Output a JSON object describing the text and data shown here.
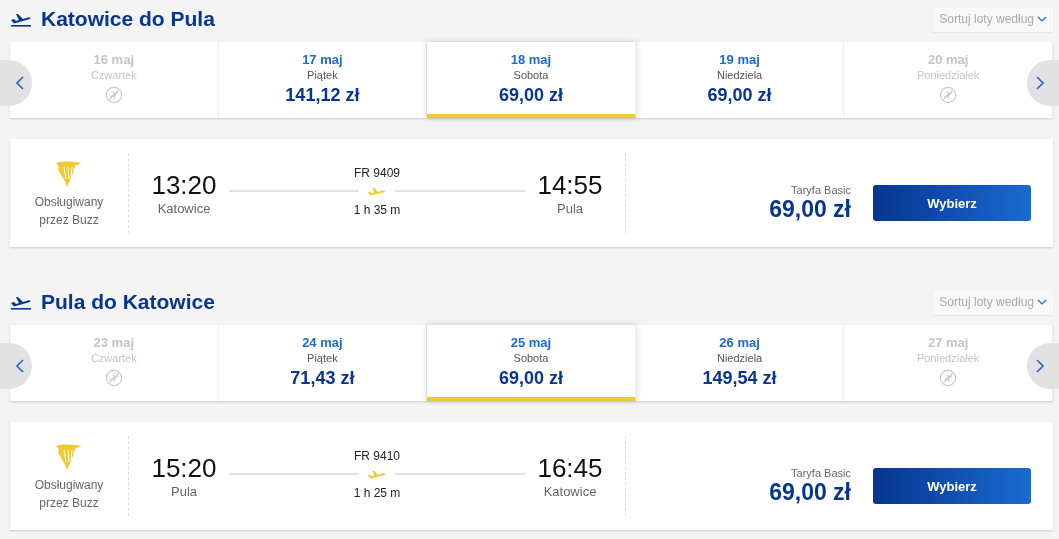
{
  "sections": [
    {
      "title": "Katowice do Pula",
      "sort": {
        "label": "Sortuj loty według"
      },
      "dates": [
        {
          "date": "16 maj",
          "day": "Czwartek",
          "available": false,
          "selected": false
        },
        {
          "date": "17 maj",
          "day": "Piątek",
          "price": "141,12 zł",
          "available": true,
          "selected": false
        },
        {
          "date": "18 maj",
          "day": "Sobota",
          "price": "69,00 zł",
          "available": true,
          "selected": true
        },
        {
          "date": "19 maj",
          "day": "Niedziela",
          "price": "69,00 zł",
          "available": true,
          "selected": false
        },
        {
          "date": "20 maj",
          "day": "Poniedziałek",
          "available": false,
          "selected": false
        }
      ],
      "flight": {
        "operator": "Obsługiwany przez Buzz",
        "departure_time": "13:20",
        "departure_city": "Katowice",
        "number": "FR 9409",
        "duration": "1 h 35 m",
        "arrival_time": "14:55",
        "arrival_city": "Pula",
        "fare": "Taryfa Basic",
        "price": "69,00 zł",
        "button": "Wybierz"
      }
    },
    {
      "title": "Pula do Katowice",
      "sort": {
        "label": "Sortuj loty według"
      },
      "dates": [
        {
          "date": "23 maj",
          "day": "Czwartek",
          "available": false,
          "selected": false
        },
        {
          "date": "24 maj",
          "day": "Piątek",
          "price": "71,43 zł",
          "available": true,
          "selected": false
        },
        {
          "date": "25 maj",
          "day": "Sobota",
          "price": "69,00 zł",
          "available": true,
          "selected": true
        },
        {
          "date": "26 maj",
          "day": "Niedziela",
          "price": "149,54 zł",
          "available": true,
          "selected": false
        },
        {
          "date": "27 maj",
          "day": "Poniedziałek",
          "available": false,
          "selected": false
        }
      ],
      "flight": {
        "operator": "Obsługiwany przez Buzz",
        "departure_time": "15:20",
        "departure_city": "Pula",
        "number": "FR 9410",
        "duration": "1 h 25 m",
        "arrival_time": "16:45",
        "arrival_city": "Katowice",
        "fare": "Taryfa Basic",
        "price": "69,00 zł",
        "button": "Wybierz"
      }
    }
  ]
}
